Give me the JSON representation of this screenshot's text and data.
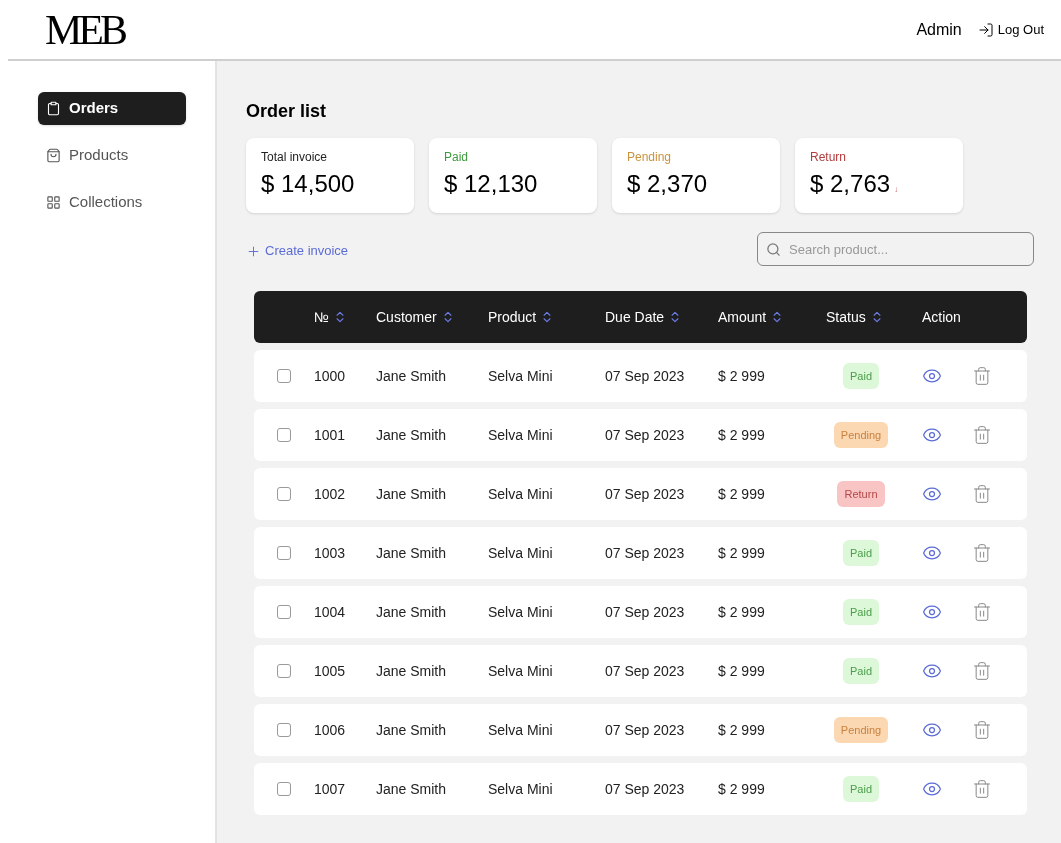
{
  "header": {
    "logo": "MEB",
    "user": "Admin",
    "logout": "Log Out"
  },
  "sidebar": {
    "items": [
      {
        "label": "Orders",
        "kind": "clipboard",
        "selected": true
      },
      {
        "label": "Products",
        "kind": "bag",
        "selected": false
      },
      {
        "label": "Collections",
        "kind": "grid",
        "selected": false
      }
    ]
  },
  "page_title": "Order list",
  "stats": [
    {
      "label": "Total invoice",
      "value": "$ 14,500",
      "kind": "total"
    },
    {
      "label": "Paid",
      "value": "$ 12,130",
      "kind": "paid"
    },
    {
      "label": "Pending",
      "value": "$ 2,370",
      "kind": "pending"
    },
    {
      "label": "Return",
      "value": "$ 2,763",
      "kind": "return",
      "trend": "↓"
    }
  ],
  "create_button": "Create invoice",
  "search": {
    "placeholder": "Search product..."
  },
  "table": {
    "columns": [
      {
        "label": "№",
        "sortable": true
      },
      {
        "label": "Customer",
        "sortable": true
      },
      {
        "label": "Product",
        "sortable": true
      },
      {
        "label": "Due Date",
        "sortable": true
      },
      {
        "label": "Amount",
        "sortable": true
      },
      {
        "label": "Status",
        "sortable": true
      },
      {
        "label": "Action",
        "sortable": false
      }
    ],
    "rows": [
      {
        "checked": false,
        "no": "1000",
        "customer": "Jane Smith",
        "product": "Selva Mini",
        "due": "07 Sep 2023",
        "amount": "$ 2 999",
        "status": "Paid",
        "kind": "paid"
      },
      {
        "checked": false,
        "no": "1001",
        "customer": "Jane Smith",
        "product": "Selva Mini",
        "due": "07 Sep 2023",
        "amount": "$ 2 999",
        "status": "Pending",
        "kind": "pending"
      },
      {
        "checked": false,
        "no": "1002",
        "customer": "Jane Smith",
        "product": "Selva Mini",
        "due": "07 Sep 2023",
        "amount": "$ 2 999",
        "status": "Return",
        "kind": "return"
      },
      {
        "checked": false,
        "no": "1003",
        "customer": "Jane Smith",
        "product": "Selva Mini",
        "due": "07 Sep 2023",
        "amount": "$ 2 999",
        "status": "Paid",
        "kind": "paid"
      },
      {
        "checked": false,
        "no": "1004",
        "customer": "Jane Smith",
        "product": "Selva Mini",
        "due": "07 Sep 2023",
        "amount": "$ 2 999",
        "status": "Paid",
        "kind": "paid"
      },
      {
        "checked": false,
        "no": "1005",
        "customer": "Jane Smith",
        "product": "Selva Mini",
        "due": "07 Sep 2023",
        "amount": "$ 2 999",
        "status": "Paid",
        "kind": "paid"
      },
      {
        "checked": false,
        "no": "1006",
        "customer": "Jane Smith",
        "product": "Selva Mini",
        "due": "07 Sep 2023",
        "amount": "$ 2 999",
        "status": "Pending",
        "kind": "pending"
      },
      {
        "checked": false,
        "no": "1007",
        "customer": "Jane Smith",
        "product": "Selva Mini",
        "due": "07 Sep 2023",
        "amount": "$ 2 999",
        "status": "Paid",
        "kind": "paid"
      }
    ]
  }
}
